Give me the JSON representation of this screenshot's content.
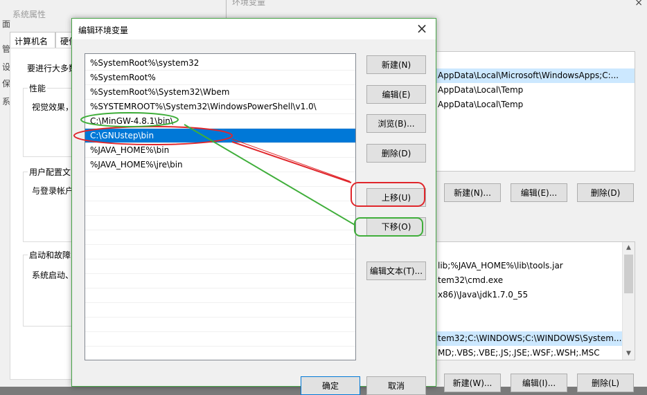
{
  "system_properties": {
    "title": "系统属性",
    "tabs": [
      "计算机名",
      "硬件"
    ],
    "intro_text": "要进行大多数",
    "performance": {
      "label": "性能",
      "text": "视觉效果，"
    },
    "user_profiles": {
      "label": "用户配置文",
      "text": "与登录帐户"
    },
    "startup": {
      "label": "启动和故障",
      "text": "系统启动、"
    },
    "side_chars": [
      "面",
      "管",
      "设",
      "保",
      "系"
    ]
  },
  "env_vars": {
    "title": "环境变量",
    "close_glyph": "×",
    "user_vars": [
      "AppData\\Local\\Microsoft\\WindowsApps;C:...",
      "AppData\\Local\\Temp",
      "AppData\\Local\\Temp"
    ],
    "user_buttons": {
      "new": "新建(N)...",
      "edit": "编辑(E)...",
      "delete": "删除(D)"
    },
    "system_vars": [
      "lib;%JAVA_HOME%\\lib\\tools.jar",
      "tem32\\cmd.exe",
      "x86)\\Java\\jdk1.7.0_55",
      "",
      "",
      "tem32;C:\\WINDOWS;C:\\WINDOWS\\System...",
      "MD;.VBS;.VBE;.JS;.JSE;.WSF;.WSH;.MSC"
    ],
    "system_buttons": {
      "new": "新建(W)...",
      "edit": "编辑(I)...",
      "delete": "删除(L)"
    }
  },
  "dialog": {
    "title": "编辑环境变量",
    "close_glyph": "×",
    "paths": [
      "%SystemRoot%\\system32",
      "%SystemRoot%",
      "%SystemRoot%\\System32\\Wbem",
      "%SYSTEMROOT%\\System32\\WindowsPowerShell\\v1.0\\",
      "C:\\MinGW-4.8.1\\bin\\",
      "C:\\GNUstep\\bin",
      "%JAVA_HOME%\\bin",
      "%JAVA_HOME%\\jre\\bin"
    ],
    "selected_index": 5,
    "buttons": {
      "new": "新建(N)",
      "edit": "编辑(E)",
      "browse": "浏览(B)...",
      "delete": "删除(D)",
      "move_up": "上移(U)",
      "move_down": "下移(O)",
      "edit_text": "编辑文本(T)...",
      "ok": "确定",
      "cancel": "取消"
    }
  },
  "annotation_colors": {
    "red": "#e0262b",
    "green": "#3fae3a"
  }
}
